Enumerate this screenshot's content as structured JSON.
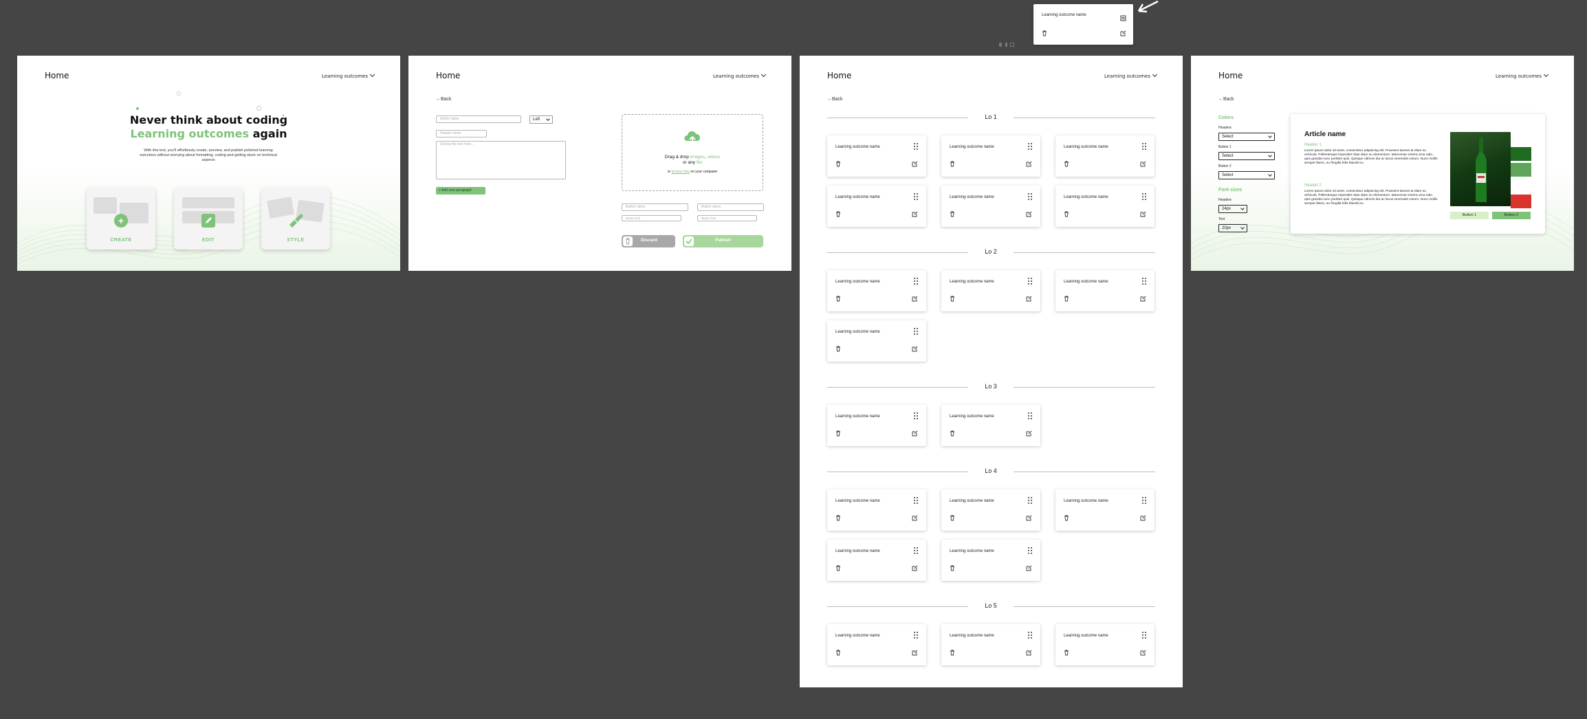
{
  "colors": {
    "accent": "#7fc27a",
    "accent_light": "#cfe8c3",
    "bg": "#454545"
  },
  "popup": {
    "card_name": "Learning outcome name"
  },
  "frame1": {
    "brand": "Home",
    "nav": "Learning outcomes",
    "headline_1": "Never think about coding",
    "headline_2a": "Learning outcomes",
    "headline_2b": " again",
    "subtitle": "With this tool, you'll effortlessly create, preview, and publish polished learning outcomes without worrying about formatting, coding and getting stuck on technical aspects",
    "tiles": [
      {
        "label": "CREATE",
        "icon": "plus-circle-icon"
      },
      {
        "label": "EDIT",
        "icon": "edit-icon"
      },
      {
        "label": "STYLE",
        "icon": "brush-icon"
      }
    ]
  },
  "frame2": {
    "brand": "Home",
    "nav": "Learning outcomes",
    "back": "Back",
    "article_placeholder": "Article name",
    "align_value": "Left",
    "header_placeholder": "Header name",
    "text_placeholder": "Storing the text here...",
    "add_paragraph": "Add new paragraph",
    "drop_line1a": "Drag & drop ",
    "drop_images": "images",
    "drop_comma": ", ",
    "drop_videos": "videos",
    "drop_line2a": "or any ",
    "drop_file": "file",
    "drop_line3a": "or ",
    "drop_browse": "browse files",
    "drop_line3b": " on your computer",
    "button1_placeholder": "Button name",
    "button2_placeholder": "Button name",
    "link1_placeholder": "Button link",
    "link2_placeholder": "Button link",
    "discard": "Discard",
    "publish": "Publish"
  },
  "frame3": {
    "brand": "Home",
    "nav": "Learning outcomes",
    "back": "Back",
    "card_name": "Learning outcome name",
    "sections": [
      {
        "title": "Lo 1",
        "count": 6
      },
      {
        "title": "Lo 2",
        "count": 4
      },
      {
        "title": "Lo 3",
        "count": 2
      },
      {
        "title": "Lo 4",
        "count": 5
      },
      {
        "title": "Lo 5",
        "count": 3
      }
    ]
  },
  "frame4": {
    "brand": "Home",
    "nav": "Learning outcomes",
    "back": "Back",
    "colors_heading": "Colors",
    "headers_label": "Headers",
    "button1_label": "Button 1",
    "button2_label": "Button 2",
    "select_value": "Select",
    "font_sizes_heading": "Font sizes",
    "fs_headers_label": "Headers",
    "fs_headers_value": "24px",
    "fs_text_label": "Text",
    "fs_text_value": "20px",
    "preview": {
      "article_name": "Article name",
      "header1": "Header 1",
      "body1": "Lorem ipsum dolor sit amet, consectetur adipiscing elit. Praesent laoreet at diam eu vehicula. Pellentesque imperdiet vitae diam eu elementum. Maecenas viverra urna odio, quis gravida nunc porttitor quis. Quisque ultrices dui ac lacus venenatis rutrum. Nunc mollis semper libero, eu fringilla felis blandit eu.",
      "header2": "Header 2",
      "body2": "Lorem ipsum dolor sit amet, consectetur adipiscing elit. Praesent laoreet at diam eu vehicula. Pellentesque imperdiet vitae diam eu elementum. Maecenas viverra urna odio, quis gravida nunc porttitor quis. Quisque ultrices dui ac lacus venenatis rutrum. Nunc mollis semper libero, eu fringilla felis blandit eu.",
      "button1": "Button 1",
      "button2": "Button 2",
      "image_icon": "bottle-photo"
    }
  }
}
